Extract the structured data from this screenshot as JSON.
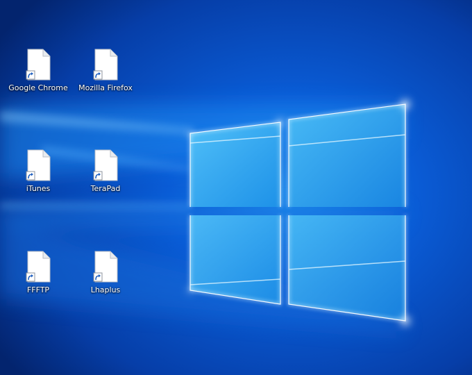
{
  "desktop": {
    "wallpaper": "windows-10-hero-wallpaper",
    "colors": {
      "background_dark": "#03246e",
      "background_mid": "#0a5cd6",
      "glow": "#bfeaff",
      "pane": "#3eb7f5"
    },
    "shortcuts": [
      {
        "label": "Google Chrome",
        "icon": "blank-document-shortcut-icon"
      },
      {
        "label": "Mozilla Firefox",
        "icon": "blank-document-shortcut-icon"
      },
      {
        "label": "iTunes",
        "icon": "blank-document-shortcut-icon"
      },
      {
        "label": "TeraPad",
        "icon": "blank-document-shortcut-icon"
      },
      {
        "label": "FFFTP",
        "icon": "blank-document-shortcut-icon"
      },
      {
        "label": "Lhaplus",
        "icon": "blank-document-shortcut-icon"
      }
    ]
  }
}
